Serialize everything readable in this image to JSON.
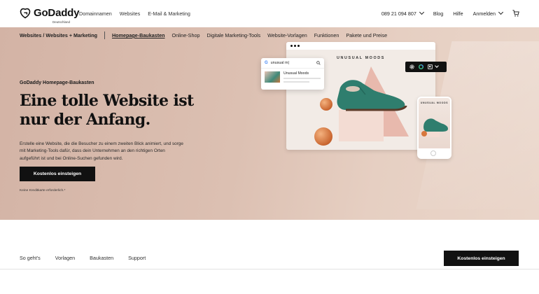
{
  "header": {
    "logo_text": "GoDaddy",
    "logo_sub": "Deutschland",
    "nav": [
      "Domainnamen",
      "Websites",
      "E-Mail & Marketing"
    ],
    "phone": "089 21 094 807",
    "blog": "Blog",
    "help": "Hilfe",
    "login": "Anmelden"
  },
  "subnav": {
    "crumb": "Websites / Websites + Marketing",
    "items": [
      "Homepage-Baukasten",
      "Online-Shop",
      "Digitale Marketing-Tools",
      "Website-Vorlagen",
      "Funktionen",
      "Pakete und Preise"
    ],
    "active_index": 0
  },
  "hero": {
    "eyebrow": "GoDaddy Homepage-Baukasten",
    "headline": "Eine tolle Website ist nur der Anfang.",
    "description": "Erstelle eine Website, die die Besucher zu einem zweiten Blick animiert, und sorge mit Marketing-Tools dafür, dass dein Unternehmen an den richtigen Orten aufgeführt ist und bei Online-Suchen gefunden wird.",
    "cta": "Kostenlos einsteigen",
    "note": "Keine Kreditkarte erforderlich.*"
  },
  "mockup": {
    "brand_title": "UNUSUAL MOODS",
    "search_query": "unusual m|",
    "search_g": "G",
    "result_title": "Unusual Moods",
    "phone_title": "UNUSUAL MOODS"
  },
  "bottom": {
    "links": [
      "So geht's",
      "Vorlagen",
      "Baukasten",
      "Support"
    ],
    "cta": "Kostenlos einsteigen"
  },
  "colors": {
    "hero_bg": "#d8b9ab",
    "button_bg": "#111111",
    "shoe": "#2f7e6e"
  }
}
